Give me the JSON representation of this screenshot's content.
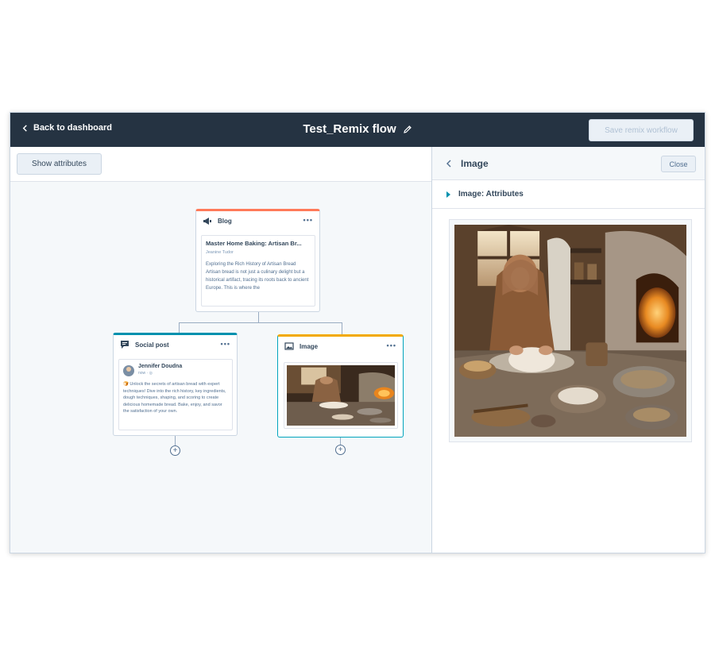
{
  "header": {
    "back_label": "Back to dashboard",
    "title": "Test_Remix flow",
    "save_label": "Save remix workflow"
  },
  "canvas": {
    "show_attributes_label": "Show attributes",
    "blog": {
      "label": "Blog",
      "post_title": "Master Home Baking: Artisan Br...",
      "author": "Jeanine Tudor",
      "excerpt": "Exploring the Rich History of Artisan Bread Artisan bread is not just a culinary delight but a historical artifact, tracing its roots back to ancient Europe. This is where the"
    },
    "social": {
      "label": "Social post",
      "user": "Jennifer Doudna",
      "time": "now · ◎",
      "text": "🍞 Unlock the secrets of artisan bread with expert techniques! Dive into the rich history, key ingredients, dough techniques, shaping, and scoring to create delicious homemade bread. Bake, enjoy, and savor the satisfaction of your own."
    },
    "image": {
      "label": "Image"
    }
  },
  "panel": {
    "title": "Image",
    "close_label": "Close",
    "attributes_label": "Image:  Attributes"
  },
  "colors": {
    "topbar": "#253342",
    "blog_accent": "#ff7a59",
    "social_accent": "#0091ae",
    "image_accent": "#f2a900",
    "selected_border": "#00a4bd"
  },
  "icons": {
    "back": "chevron-left-icon",
    "edit": "pencil-icon",
    "blog": "megaphone-icon",
    "social": "chat-icon",
    "image": "image-icon",
    "more": "more-options-icon",
    "add": "plus-circle-icon",
    "expand": "caret-right-icon"
  }
}
